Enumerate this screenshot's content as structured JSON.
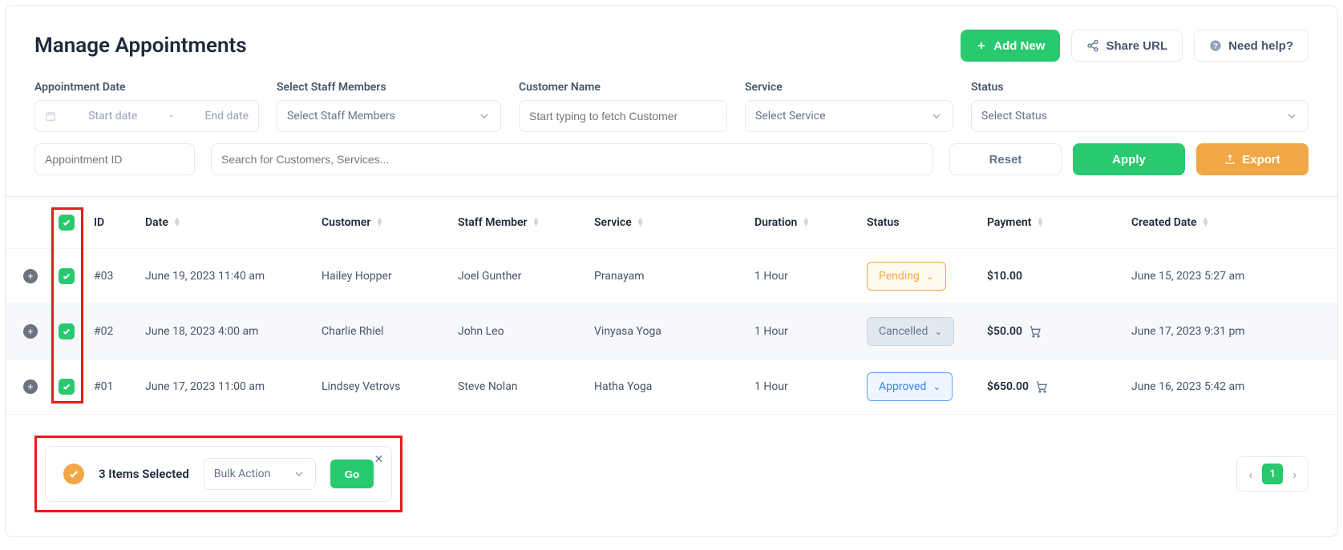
{
  "header": {
    "title": "Manage Appointments",
    "add_new": "Add New",
    "share_url": "Share URL",
    "need_help": "Need help?"
  },
  "filters": {
    "date_label": "Appointment Date",
    "date_start_placeholder": "Start date",
    "date_dash": "-",
    "date_end_placeholder": "End date",
    "staff_label": "Select Staff Members",
    "staff_placeholder": "Select Staff Members",
    "customer_label": "Customer Name",
    "customer_placeholder": "Start typing to fetch Customer",
    "service_label": "Service",
    "service_placeholder": "Select Service",
    "status_label": "Status",
    "status_placeholder": "Select Status",
    "appt_id_placeholder": "Appointment ID",
    "search_placeholder": "Search for Customers, Services...",
    "reset": "Reset",
    "apply": "Apply",
    "export": "Export"
  },
  "table": {
    "columns": {
      "id": "ID",
      "date": "Date",
      "customer": "Customer",
      "staff": "Staff Member",
      "service": "Service",
      "duration": "Duration",
      "status": "Status",
      "payment": "Payment",
      "created": "Created Date"
    },
    "rows": [
      {
        "id": "#03",
        "date": "June 19, 2023 11:40 am",
        "customer": "Hailey Hopper",
        "staff": "Joel Gunther",
        "service": "Pranayam",
        "duration": "1 Hour",
        "status_label": "Pending",
        "status_kind": "pending",
        "payment": "$10.00",
        "has_cart": false,
        "created": "June 15, 2023 5:27 am"
      },
      {
        "id": "#02",
        "date": "June 18, 2023 4:00 am",
        "customer": "Charlie Rhiel",
        "staff": "John Leo",
        "service": "Vinyasa Yoga",
        "duration": "1 Hour",
        "status_label": "Cancelled",
        "status_kind": "cancelled",
        "payment": "$50.00",
        "has_cart": true,
        "created": "June 17, 2023 9:31 pm"
      },
      {
        "id": "#01",
        "date": "June 17, 2023 11:00 am",
        "customer": "Lindsey Vetrovs",
        "staff": "Steve Nolan",
        "service": "Hatha Yoga",
        "duration": "1 Hour",
        "status_label": "Approved",
        "status_kind": "approved",
        "payment": "$650.00",
        "has_cart": true,
        "created": "June 16, 2023 5:42 am"
      }
    ]
  },
  "bulk": {
    "selected_label": "3 Items Selected",
    "action_placeholder": "Bulk Action",
    "go": "Go"
  },
  "pager": {
    "page": "1"
  }
}
